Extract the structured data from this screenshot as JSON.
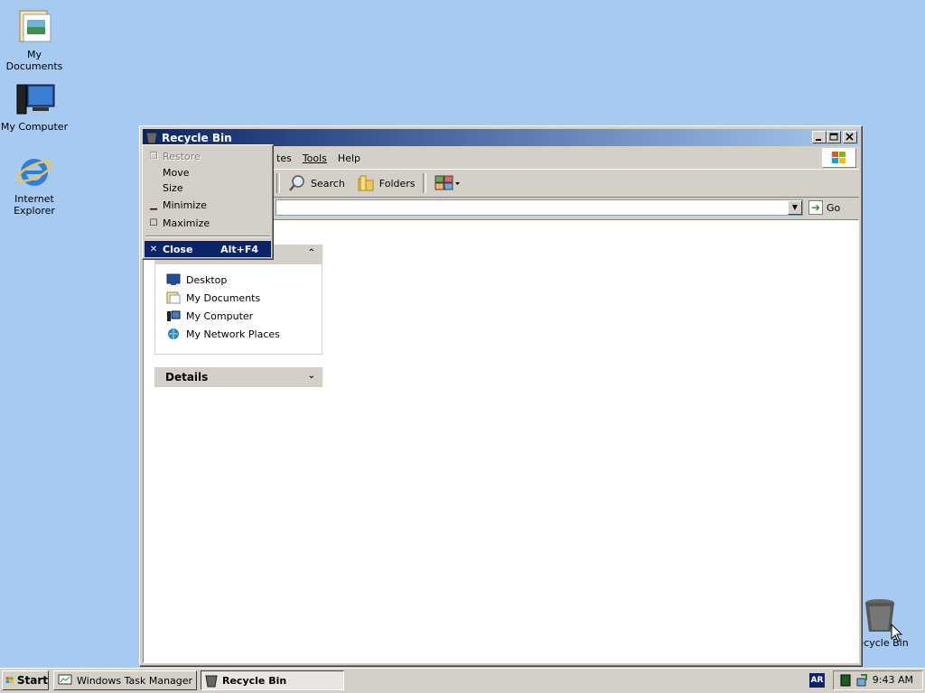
{
  "desktop": {
    "icons": [
      {
        "label": "My Documents"
      },
      {
        "label": "My Computer"
      },
      {
        "label": "Internet Explorer"
      },
      {
        "label": "Recycle Bin"
      }
    ]
  },
  "window": {
    "title": "Recycle Bin",
    "menu": {
      "partial_favorites": "tes",
      "tools": "Tools",
      "help": "Help"
    },
    "toolbar": {
      "search": "Search",
      "folders": "Folders"
    },
    "address": {
      "go": "Go"
    },
    "other_places": {
      "items": [
        "Desktop",
        "My Documents",
        "My Computer",
        "My Network Places"
      ]
    },
    "details": {
      "title": "Details"
    }
  },
  "system_menu": {
    "restore": "Restore",
    "move": "Move",
    "size": "Size",
    "minimize": "Minimize",
    "maximize": "Maximize",
    "close": "Close",
    "close_accel": "Alt+F4"
  },
  "taskbar": {
    "start": "Start",
    "tasks": [
      "Windows Task Manager",
      "Recycle Bin"
    ],
    "language": "AR",
    "clock": "9:43 AM"
  },
  "colors": {
    "desktop": "#a6caf0",
    "titlebar": "#0a246a",
    "selection": "#0a246a"
  }
}
